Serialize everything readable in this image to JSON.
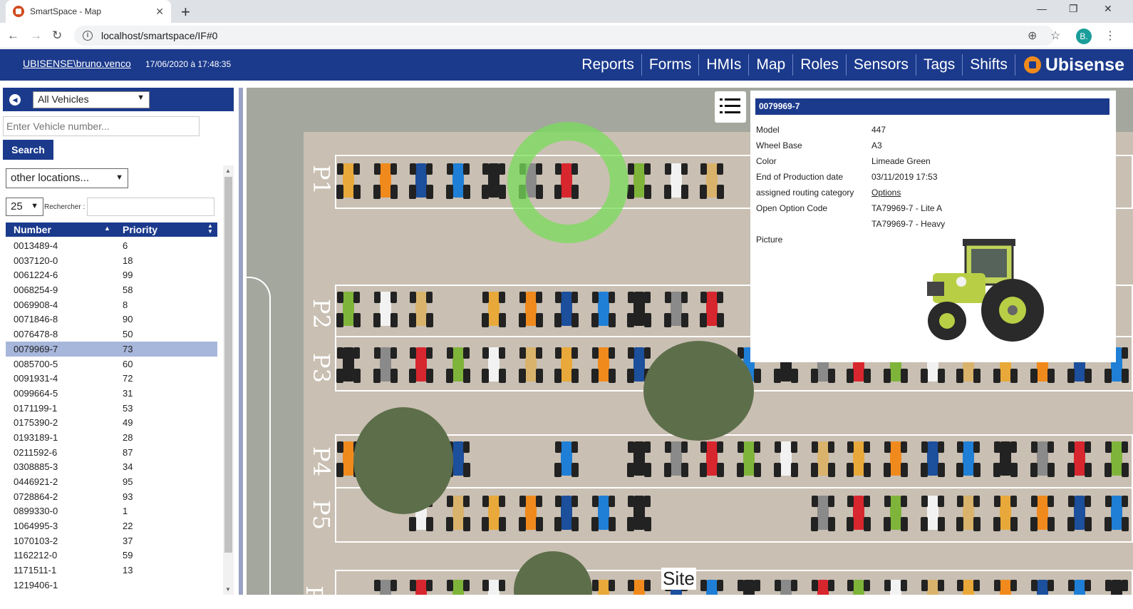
{
  "browser": {
    "tab_title": "SmartSpace - Map",
    "url": "localhost/smartspace/IF#0",
    "profile_initial": "B."
  },
  "header": {
    "user": "UBISENSE\\bruno.venco",
    "datetime": "17/06/2020 à 17:48:35",
    "nav": [
      "Reports",
      "Forms",
      "HMIs",
      "Map",
      "Roles",
      "Sensors",
      "Tags",
      "Shifts"
    ],
    "brand": "Ubisense"
  },
  "filters": {
    "vehicle_filter": "All Vehicles",
    "vehicle_placeholder": "Enter Vehicle number...",
    "search_label": "Search",
    "location_filter": "other locations...",
    "page_length": "25",
    "search_label2": "Rechercher :"
  },
  "table": {
    "headers": [
      "Number",
      "Priority"
    ],
    "rows": [
      [
        "0013489-4",
        "6"
      ],
      [
        "0037120-0",
        "18"
      ],
      [
        "0061224-6",
        "99"
      ],
      [
        "0068254-9",
        "58"
      ],
      [
        "0069908-4",
        "8"
      ],
      [
        "0071846-8",
        "90"
      ],
      [
        "0076478-8",
        "50"
      ],
      [
        "0079969-7",
        "73"
      ],
      [
        "0085700-5",
        "60"
      ],
      [
        "0091931-4",
        "72"
      ],
      [
        "0099664-5",
        "31"
      ],
      [
        "0171199-1",
        "53"
      ],
      [
        "0175390-2",
        "49"
      ],
      [
        "0193189-1",
        "28"
      ],
      [
        "0211592-6",
        "87"
      ],
      [
        "0308885-3",
        "34"
      ],
      [
        "0446921-2",
        "95"
      ],
      [
        "0728864-2",
        "93"
      ],
      [
        "0899330-0",
        "1"
      ],
      [
        "1064995-3",
        "22"
      ],
      [
        "1070103-2",
        "37"
      ],
      [
        "1162212-0",
        "59"
      ],
      [
        "1171511-1",
        "13"
      ],
      [
        "1219406-1",
        ""
      ]
    ],
    "selected_index": 7
  },
  "map": {
    "row_labels": [
      "P1",
      "P2",
      "P3",
      "P4",
      "P5",
      "P"
    ],
    "site_label": "Site",
    "tractor_colors": [
      "#e8a93a",
      "#7fb43a",
      "#222222",
      "#f08a1d",
      "#f2f2f2",
      "#8a8a8a",
      "#1c4f9c",
      "#d9b36b",
      "#d8262e",
      "#1f7fd6"
    ]
  },
  "info": {
    "title": "0079969-7",
    "fields": [
      {
        "label": "Model",
        "value": "447"
      },
      {
        "label": "Wheel Base",
        "value": "A3"
      },
      {
        "label": "Color",
        "value": "Limeade Green"
      },
      {
        "label": "End of Production date",
        "value": "03/11/2019 17:53"
      },
      {
        "label": "assigned routing category",
        "value": "Options"
      },
      {
        "label": "Open Option Code",
        "value": "TA79969-7 - Lite A"
      },
      {
        "label": "",
        "value": "TA79969-7 - Heavy"
      },
      {
        "label": "Picture",
        "value": ""
      }
    ]
  }
}
